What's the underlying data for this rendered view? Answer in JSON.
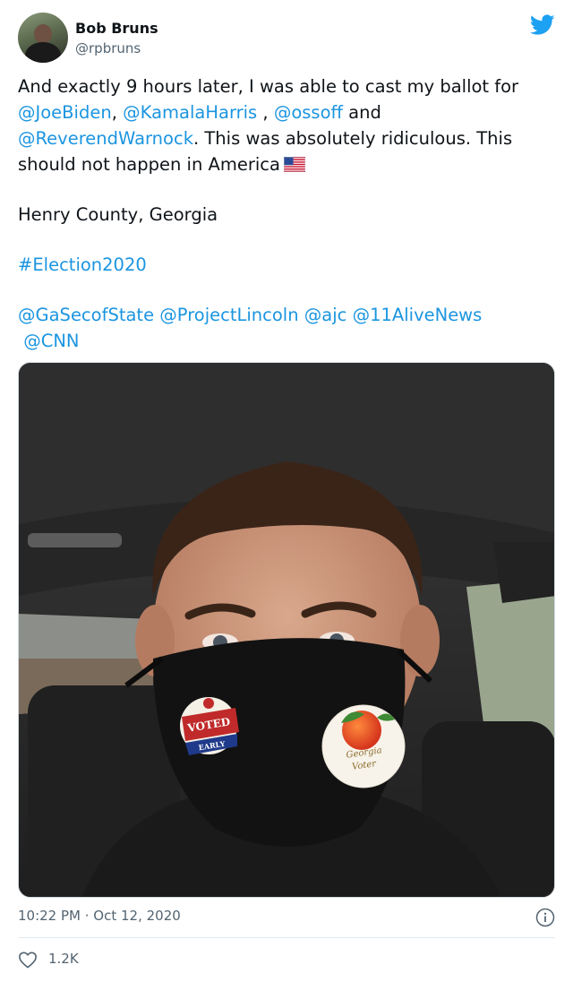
{
  "author": {
    "name": "Bob Bruns",
    "handle": "@rpbruns"
  },
  "tweet": {
    "line1": "And exactly 9 hours later, I was able to cast my ballot for ",
    "mention_biden": "@JoeBiden",
    "comma1": ", ",
    "mention_harris": "@KamalaHarris",
    "comma2": " , ",
    "mention_ossoff": "@ossoff",
    "and": " and ",
    "mention_warnock": "@ReverendWarnock",
    "rest": ". This was absolutely ridiculous. This should not happen in America",
    "location": "Henry County, Georgia",
    "hashtag": "#Election2020",
    "mention_gasec": "@GaSecofState",
    "mention_lincoln": "@ProjectLincoln",
    "mention_ajc": "@ajc",
    "mention_11alive": "@11AliveNews",
    "mention_cnn": "@CNN"
  },
  "photo": {
    "sticker_voted_line1": "VOTED",
    "sticker_voted_line2": "EARLY",
    "sticker_georgia_line1": "Georgia",
    "sticker_georgia_line2": "Voter"
  },
  "meta": {
    "timestamp": "10:22 PM · Oct 12, 2020"
  },
  "engagement": {
    "likes": "1.2K"
  },
  "colors": {
    "link": "#1b95e0",
    "twitter_blue": "#1da1f2",
    "secondary_text": "#536471"
  },
  "icons": {
    "brand": "twitter-bird-icon",
    "flag": "us-flag-emoji",
    "info": "info-icon",
    "like": "heart-icon"
  }
}
